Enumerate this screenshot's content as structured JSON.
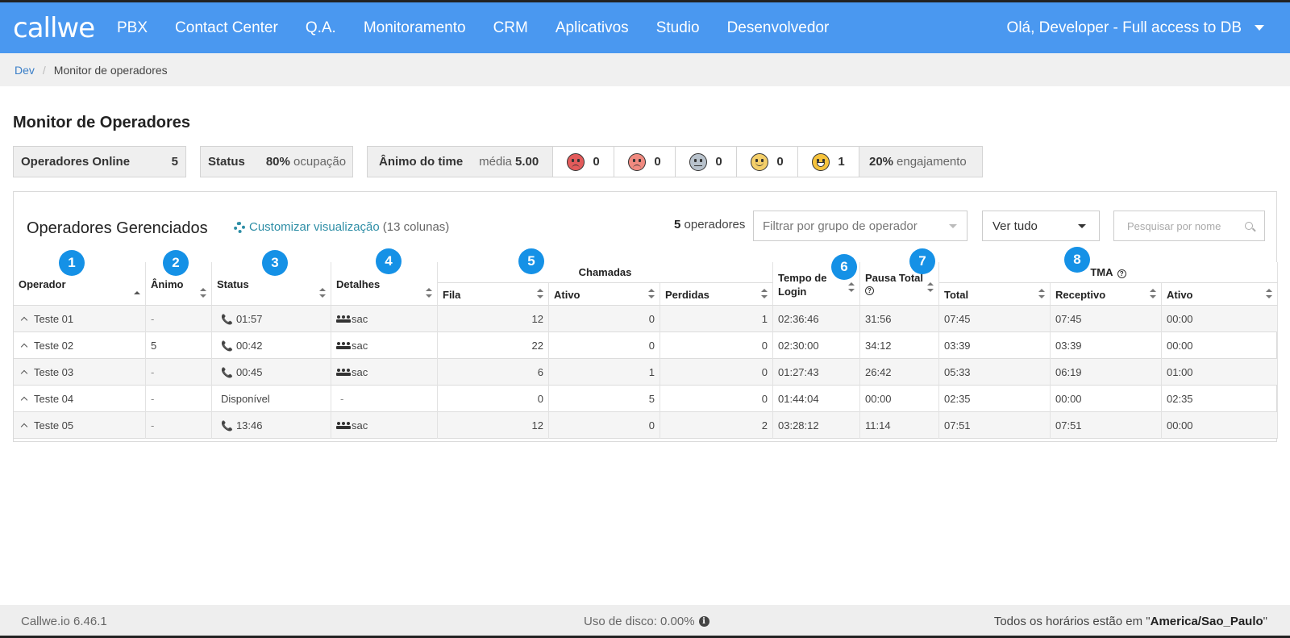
{
  "app": {
    "logo": "callwe",
    "nav": [
      "PBX",
      "Contact Center",
      "Q.A.",
      "Monitoramento",
      "CRM",
      "Aplicativos",
      "Studio",
      "Desenvolvedor"
    ],
    "user_menu": "Olá, Developer - Full access to DB"
  },
  "breadcrumb": {
    "root": "Dev",
    "current": "Monitor de operadores"
  },
  "page": {
    "title": "Monitor de Operadores"
  },
  "stats": {
    "online_label": "Operadores Online",
    "online_count": "5",
    "status_label": "Status",
    "occupancy_value": "80%",
    "occupancy_label": "ocupação",
    "team_mood_label": "Ânimo do time",
    "average_label": "média",
    "average_value": "5.00",
    "moods": [
      {
        "icon": "angry-face-icon",
        "color": "#e35b5b",
        "count": "0"
      },
      {
        "icon": "sad-face-icon",
        "color": "#f08a80",
        "count": "0"
      },
      {
        "icon": "neutral-face-icon",
        "color": "#b8c2cc",
        "count": "0"
      },
      {
        "icon": "smile-face-icon",
        "color": "#f4cf6a",
        "count": "0"
      },
      {
        "icon": "grin-face-icon",
        "color": "#f6c33c",
        "count": "1"
      }
    ],
    "engagement_value": "20%",
    "engagement_label": "engajamento"
  },
  "panel": {
    "title": "Operadores Gerenciados",
    "customize_label": "Customizar visualização",
    "columns_note": "(13 colunas)",
    "operator_count": "5",
    "operator_count_label": "operadores",
    "group_filter_placeholder": "Filtrar por grupo de operador",
    "view_filter": "Ver tudo",
    "search_placeholder": "Pesquisar por nome"
  },
  "table": {
    "headers": {
      "operador": "Operador",
      "animo": "Ânimo",
      "status": "Status",
      "detalhes": "Detalhes",
      "chamadas": "Chamadas",
      "fila": "Fila",
      "ativo": "Ativo",
      "perdidas": "Perdidas",
      "tempo_login_1": "Tempo de",
      "tempo_login_2": "Login",
      "pausa_total": "Pausa Total",
      "tma": "TMA",
      "tma_total": "Total",
      "tma_receptivo": "Receptivo",
      "tma_ativo": "Ativo"
    },
    "badges": [
      "1",
      "2",
      "3",
      "4",
      "5",
      "6",
      "7",
      "8"
    ],
    "rows": [
      {
        "operador": "Teste 01",
        "animo": "-",
        "status": "01:57",
        "on_call": true,
        "detalhes": "sac",
        "fila": "12",
        "ativo": "0",
        "perdidas": "1",
        "tempo_login": "02:36:46",
        "pausa_total": "31:56",
        "tma_total": "07:45",
        "tma_receptivo": "07:45",
        "tma_ativo": "00:00"
      },
      {
        "operador": "Teste 02",
        "animo": "5",
        "status": "00:42",
        "on_call": true,
        "detalhes": "sac",
        "fila": "22",
        "ativo": "0",
        "perdidas": "0",
        "tempo_login": "02:30:00",
        "pausa_total": "34:12",
        "tma_total": "03:39",
        "tma_receptivo": "03:39",
        "tma_ativo": "00:00"
      },
      {
        "operador": "Teste 03",
        "animo": "-",
        "status": "00:45",
        "on_call": true,
        "detalhes": "sac",
        "fila": "6",
        "ativo": "1",
        "perdidas": "0",
        "tempo_login": "01:27:43",
        "pausa_total": "26:42",
        "tma_total": "05:33",
        "tma_receptivo": "06:19",
        "tma_ativo": "01:00"
      },
      {
        "operador": "Teste 04",
        "animo": "-",
        "status": "Disponível",
        "on_call": false,
        "detalhes": "-",
        "fila": "0",
        "ativo": "5",
        "perdidas": "0",
        "tempo_login": "01:44:04",
        "pausa_total": "00:00",
        "tma_total": "02:35",
        "tma_receptivo": "00:00",
        "tma_ativo": "02:35"
      },
      {
        "operador": "Teste 05",
        "animo": "-",
        "status": "13:46",
        "on_call": true,
        "detalhes": "sac",
        "fila": "12",
        "ativo": "0",
        "perdidas": "2",
        "tempo_login": "03:28:12",
        "pausa_total": "11:14",
        "tma_total": "07:51",
        "tma_receptivo": "07:51",
        "tma_ativo": "00:00"
      }
    ]
  },
  "footer": {
    "version": "Callwe.io 6.46.1",
    "disk_usage": "Uso de disco: 0.00%",
    "timezone_prefix": "Todos os horários estão em \"",
    "timezone": "America/Sao_Paulo",
    "timezone_suffix": "\""
  },
  "colors": {
    "topbar": "#4a98f0",
    "badge": "#1591e6",
    "link": "#2e8ea6"
  }
}
